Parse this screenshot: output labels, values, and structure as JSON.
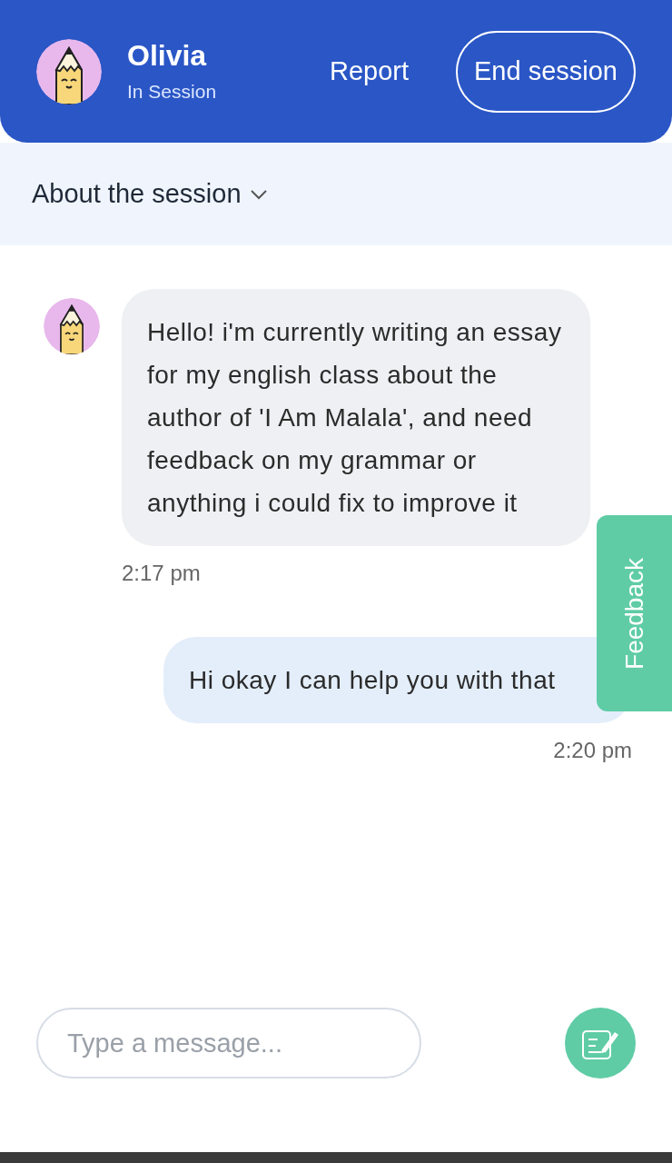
{
  "header": {
    "name": "Olivia",
    "status": "In Session",
    "report": "Report",
    "end_session": "End session"
  },
  "about": {
    "label": "About the session",
    "expanded": false
  },
  "messages": [
    {
      "kind": "received",
      "text": "Hello! i'm currently writing an essay for my english class about the author of 'I Am Malala', and need feedback on my grammar or anything i could fix to improve it",
      "time": "2:17 pm"
    },
    {
      "kind": "sent",
      "text": "Hi okay I can help you with that",
      "time": "2:20 pm"
    }
  ],
  "feedback_tab": "Feedback",
  "composer": {
    "placeholder": "Type a message..."
  }
}
